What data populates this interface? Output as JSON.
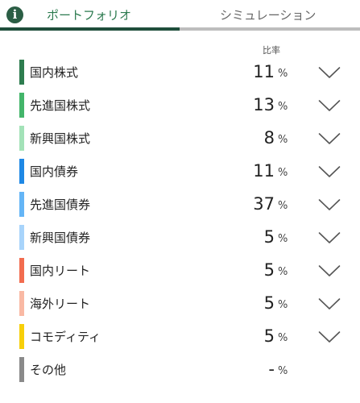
{
  "tabs": {
    "portfolio_label": "ポートフォリオ",
    "simulation_label": "シミュレーション",
    "active": "portfolio"
  },
  "header": {
    "ratio_label": "比率"
  },
  "icons": {
    "info": "info-icon",
    "expand": "chevron-down-icon"
  },
  "colors": {
    "active_tab_text": "#2b7a4e",
    "active_tab_underline": "#1f4e3b",
    "inactive_tab_underline": "#bdbdbd"
  },
  "unit": "%",
  "assets": [
    {
      "label": "国内株式",
      "value": "11",
      "color": "#2e7d4f",
      "expandable": true
    },
    {
      "label": "先進国株式",
      "value": "13",
      "color": "#43b56a",
      "expandable": true
    },
    {
      "label": "新興国株式",
      "value": "8",
      "color": "#a3e2b8",
      "expandable": true
    },
    {
      "label": "国内債券",
      "value": "11",
      "color": "#1e88e5",
      "expandable": true
    },
    {
      "label": "先進国債券",
      "value": "37",
      "color": "#64b5f6",
      "expandable": true
    },
    {
      "label": "新興国債券",
      "value": "5",
      "color": "#a8d4fb",
      "expandable": true
    },
    {
      "label": "国内リート",
      "value": "5",
      "color": "#f26c4f",
      "expandable": true
    },
    {
      "label": "海外リート",
      "value": "5",
      "color": "#f9b9a4",
      "expandable": true
    },
    {
      "label": "コモディティ",
      "value": "5",
      "color": "#f7cf0a",
      "expandable": true
    },
    {
      "label": "その他",
      "value": "-",
      "color": "#8a8a8a",
      "expandable": false
    }
  ]
}
